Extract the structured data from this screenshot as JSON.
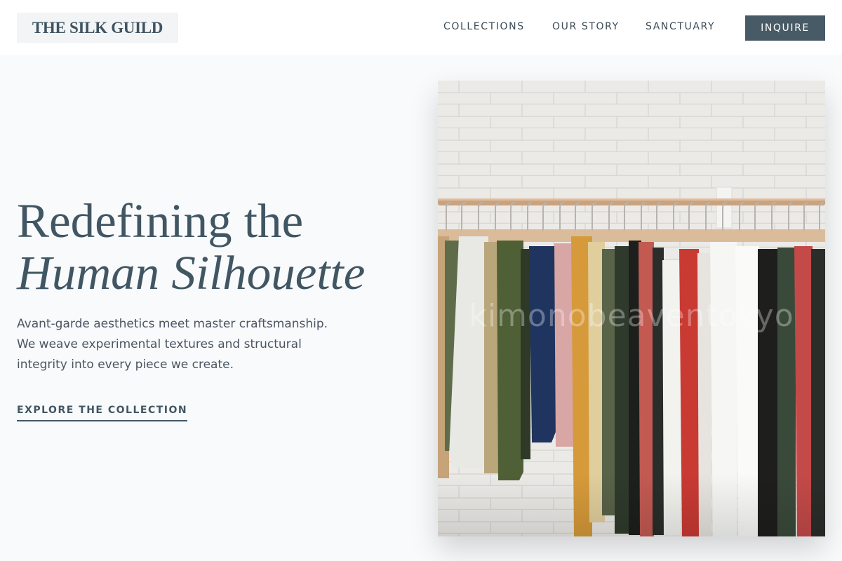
{
  "header": {
    "logo": "THE SILK GUILD",
    "nav": [
      {
        "label": "COLLECTIONS"
      },
      {
        "label": "OUR STORY"
      },
      {
        "label": "SANCTUARY"
      }
    ],
    "cta_label": "INQUIRE"
  },
  "hero": {
    "headline_line1": "Redefining the",
    "headline_line2": "Human Silhouette",
    "description": "Avant-garde aesthetics meet master craftsmanship. We weave experimental textures and structural integrity into every piece we create.",
    "link_label": "EXPLORE THE COLLECTION"
  },
  "image": {
    "subject": "clothing rack with garments on wooden hangers",
    "watermark": "kimonobeaventokyo"
  },
  "colors": {
    "accent": "#475a66",
    "text": "#3f5461",
    "background": "#f9fafb"
  }
}
